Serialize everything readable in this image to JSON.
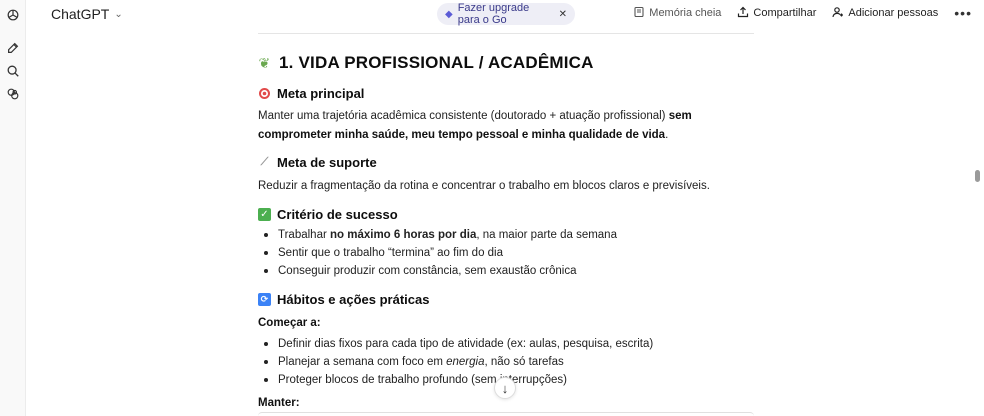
{
  "header": {
    "model_name": "ChatGPT",
    "upgrade_label": "Fazer upgrade para o Go",
    "memory_label": "Memória cheia",
    "share_label": "Compartilhar",
    "add_people_label": "Adicionar pessoas",
    "more_label": "•••"
  },
  "content": {
    "section_title": "1. VIDA PROFISSIONAL / ACADÊMICA",
    "main_goal": {
      "heading": "Meta principal",
      "text_plain": "Manter uma trajetória acadêmica consistente (doutorado + atuação profissional) ",
      "text_bold": "sem comprometer minha saúde, meu tempo pessoal e minha qualidade de vida",
      "text_end": "."
    },
    "support_goal": {
      "heading": "Meta de suporte",
      "text": "Reduzir a fragmentação da rotina e concentrar o trabalho em blocos claros e previsíveis."
    },
    "success": {
      "heading": "Critério de sucesso",
      "item1_pre": "Trabalhar ",
      "item1_bold": "no máximo 6 horas por dia",
      "item1_post": ", na maior parte da semana",
      "item2": "Sentir que o trabalho “termina” ao fim do dia",
      "item3": "Conseguir produzir com constância, sem exaustão crônica"
    },
    "habits": {
      "heading": "Hábitos e ações práticas",
      "start_label": "Começar a:",
      "item1": "Definir dias fixos para cada tipo de atividade (ex: aulas, pesquisa, escrita)",
      "item2_pre": "Planejar a semana com foco em ",
      "item2_em": "energia",
      "item2_post": ", não só tarefas",
      "item3": "Proteger blocos de trabalho profundo (sem interrupções)",
      "keep_label": "Manter:"
    }
  },
  "icons": {
    "rail": [
      "chatgpt-logo-icon",
      "new-chat-icon",
      "search-icon",
      "apps-icon"
    ],
    "scroll_down": "↓"
  },
  "colors": {
    "accent_upgrade_bg": "#eeeef6",
    "accent_upgrade_text": "#3a3a8a"
  }
}
